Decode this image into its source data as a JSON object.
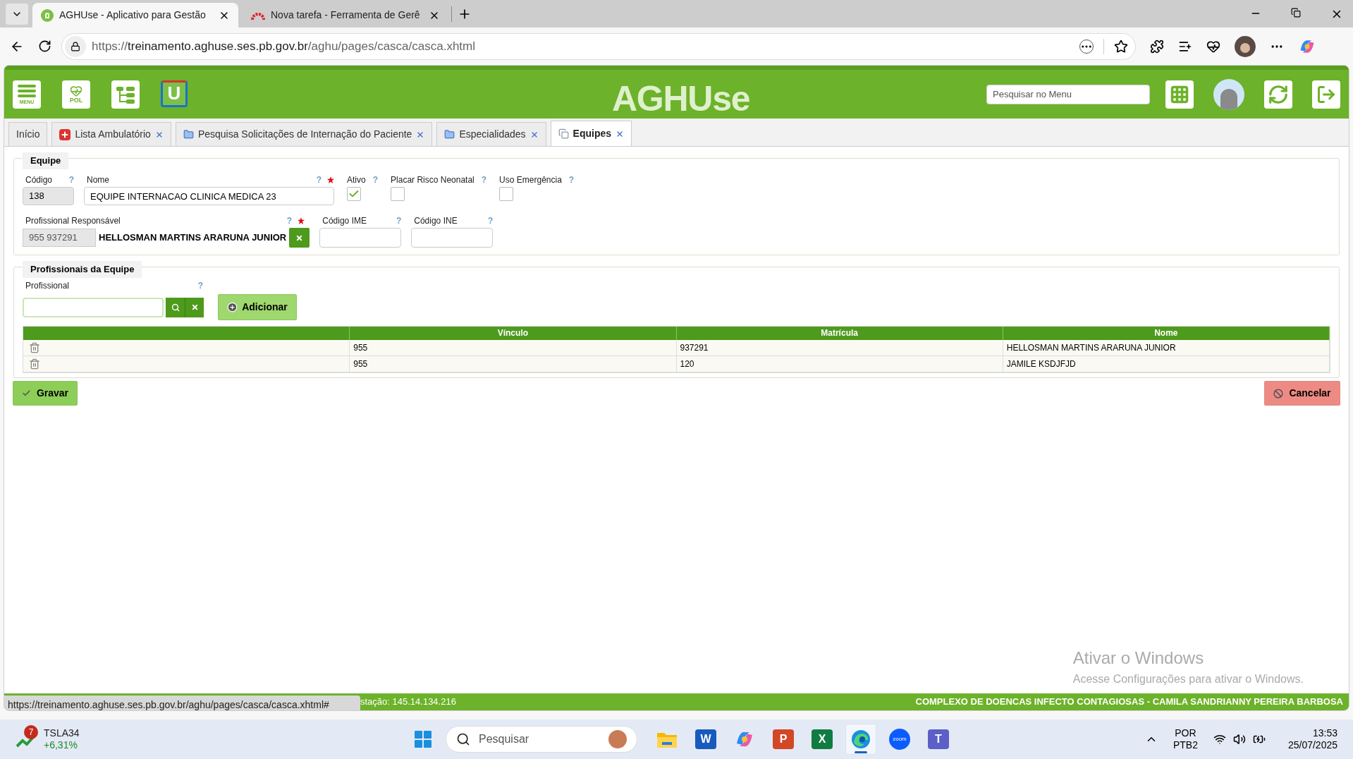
{
  "browser": {
    "tabs": [
      {
        "title": "AGHUse - Aplicativo para Gestão",
        "selected": true
      },
      {
        "title": "Nova tarefa - Ferramenta de Gerê",
        "selected": false
      }
    ],
    "url": {
      "scheme": "https://",
      "host": "treinamento.aghuse.ses.pb.gov.br",
      "path": "/aghu/pages/casca/casca.xhtml"
    }
  },
  "app_header": {
    "menu_label": "MENU",
    "pol_label": "POL",
    "u_label": "U",
    "logo": "AGHUse",
    "search": {
      "placeholder": "Pesquisar no Menu"
    }
  },
  "tabs": [
    {
      "label": "Início",
      "selected": false,
      "closable": false,
      "kind": "plain"
    },
    {
      "label": "Lista Ambulatório",
      "selected": false,
      "closable": true,
      "kind": "cross"
    },
    {
      "label": "Pesquisa Solicitações de Internação do Paciente",
      "selected": false,
      "closable": true,
      "kind": "folder"
    },
    {
      "label": "Especialidades",
      "selected": false,
      "closable": true,
      "kind": "folder"
    },
    {
      "label": "Equipes",
      "selected": true,
      "closable": true,
      "kind": "people"
    }
  ],
  "equipe": {
    "legend": "Equipe",
    "codigo": {
      "label": "Código",
      "help": "?",
      "value": "138"
    },
    "nome": {
      "label": "Nome",
      "help": "?",
      "required": true,
      "value": "EQUIPE INTERNACAO CLINICA MEDICA 23"
    },
    "flags": [
      {
        "label": "Ativo",
        "help": "?",
        "checked": true
      },
      {
        "label": "Placar Risco Neonatal",
        "help": "?",
        "checked": false
      },
      {
        "label": "Uso Emergência",
        "help": "?",
        "checked": false
      }
    ],
    "responsavel": {
      "label": "Profissional Responsável",
      "help": "?",
      "required": true,
      "code": "955 937291",
      "name": "HELLOSMAN MARTINS ARARUNA JUNIOR"
    },
    "ime": {
      "label": "Código IME",
      "help": "?"
    },
    "ine": {
      "label": "Código INE",
      "help": "?"
    }
  },
  "profissionais": {
    "legend": "Profissionais da Equipe",
    "field": {
      "label": "Profissional",
      "help": "?"
    },
    "add_button": "Adicionar",
    "table": {
      "columns": [
        "Vínculo",
        "Matrícula",
        "Nome"
      ],
      "rows": [
        [
          "955",
          "937291",
          "HELLOSMAN MARTINS ARARUNA JUNIOR"
        ],
        [
          "955",
          "120",
          "JAMILE KSDJFJD"
        ]
      ]
    }
  },
  "actions": {
    "save": "Gravar",
    "cancel": "Cancelar"
  },
  "windows_notice": {
    "title": "Ativar o Windows",
    "text": "Acesse Configurações para ativar o Windows."
  },
  "status_bar": {
    "left": "stação: 145.14.134.216",
    "right": "COMPLEXO DE DOENCAS INFECTO CONTAGIOSAS - CAMILA SANDRIANNY PEREIRA BARBOSA"
  },
  "link_tooltip": "https://treinamento.aghuse.ses.pb.gov.br/aghu/pages/casca/casca.xhtml#",
  "taskbar": {
    "widget": {
      "badge": "7",
      "symbol": "TSLA34",
      "change": "+6,31%"
    },
    "search": {
      "placeholder": "Pesquisar"
    },
    "apps": [
      {
        "kind": "explorer",
        "selected": false
      },
      {
        "kind": "word",
        "letter": "W",
        "selected": false
      },
      {
        "kind": "copilot",
        "selected": false
      },
      {
        "kind": "powerpoint",
        "letter": "P",
        "selected": false
      },
      {
        "kind": "excel",
        "letter": "X",
        "selected": false
      },
      {
        "kind": "edge",
        "selected": true
      },
      {
        "kind": "zoom",
        "letter": "zoom",
        "selected": false
      },
      {
        "kind": "teams",
        "letter": "T",
        "selected": false
      }
    ],
    "language": "POR",
    "layout": "PTB2",
    "time": "13:53",
    "date": "25/07/2025"
  }
}
